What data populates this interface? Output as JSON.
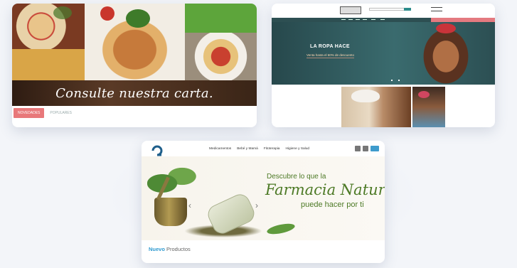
{
  "restaurant": {
    "banner": "Consulte nuestra carta.",
    "tabs": [
      "NOVEDADES",
      "POPULARES"
    ]
  },
  "fashion": {
    "hero_title": "LA ROPA HACE",
    "hero_sub": "Venta hasta el 60% de descuento"
  },
  "pharmacy": {
    "nav": [
      "Medicamentos",
      "Bebé y Mamá",
      "Fitoterapia",
      "Higiene y Salud"
    ],
    "hero_line1": "Descubre lo que la",
    "hero_line2": "Farmacia Natural",
    "hero_line3": "puede hacer por ti",
    "footer_accent": "Nuevo",
    "footer_rest": "Productos"
  },
  "colors": {
    "accent_pink": "#e8787a",
    "teal": "#3a6b6e",
    "pharmacy_green": "#4d7a26",
    "pharmacy_blue": "#2f9ad0"
  }
}
